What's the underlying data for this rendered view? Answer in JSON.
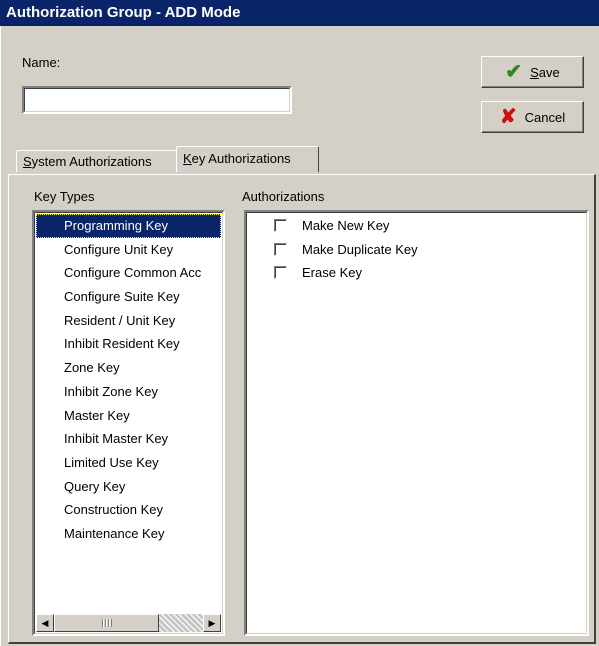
{
  "window": {
    "title": "Authorization Group - ADD Mode"
  },
  "form": {
    "name_label": "Name:",
    "name_value": "",
    "name_placeholder": ""
  },
  "buttons": {
    "save": {
      "underline": "S",
      "rest": "ave"
    },
    "cancel": {
      "label": "Cancel"
    }
  },
  "tabs": [
    {
      "underline": "S",
      "rest": "ystem Authorizations",
      "active": false
    },
    {
      "underline": "K",
      "rest": "ey Authorizations",
      "active": true
    }
  ],
  "key_types": {
    "header": "Key Types",
    "selected": "Programming Key",
    "items": [
      "Programming Key",
      "Configure Unit Key",
      "Configure Common Acc",
      "Configure Suite Key",
      "Resident / Unit Key",
      "Inhibit Resident Key",
      "Zone Key",
      "Inhibit Zone Key",
      "Master Key",
      "Inhibit Master Key",
      "Limited Use Key",
      "Query Key",
      "Construction Key",
      "Maintenance Key"
    ]
  },
  "authorizations": {
    "header": "Authorizations",
    "items": [
      {
        "label": "Make New Key",
        "checked": false
      },
      {
        "label": "Make Duplicate Key",
        "checked": false
      },
      {
        "label": "Erase Key",
        "checked": false
      }
    ]
  },
  "icons": {
    "save": "checkmark-icon",
    "cancel": "x-icon",
    "save_color": "#2a8a1a",
    "cancel_color": "#cc1010"
  }
}
